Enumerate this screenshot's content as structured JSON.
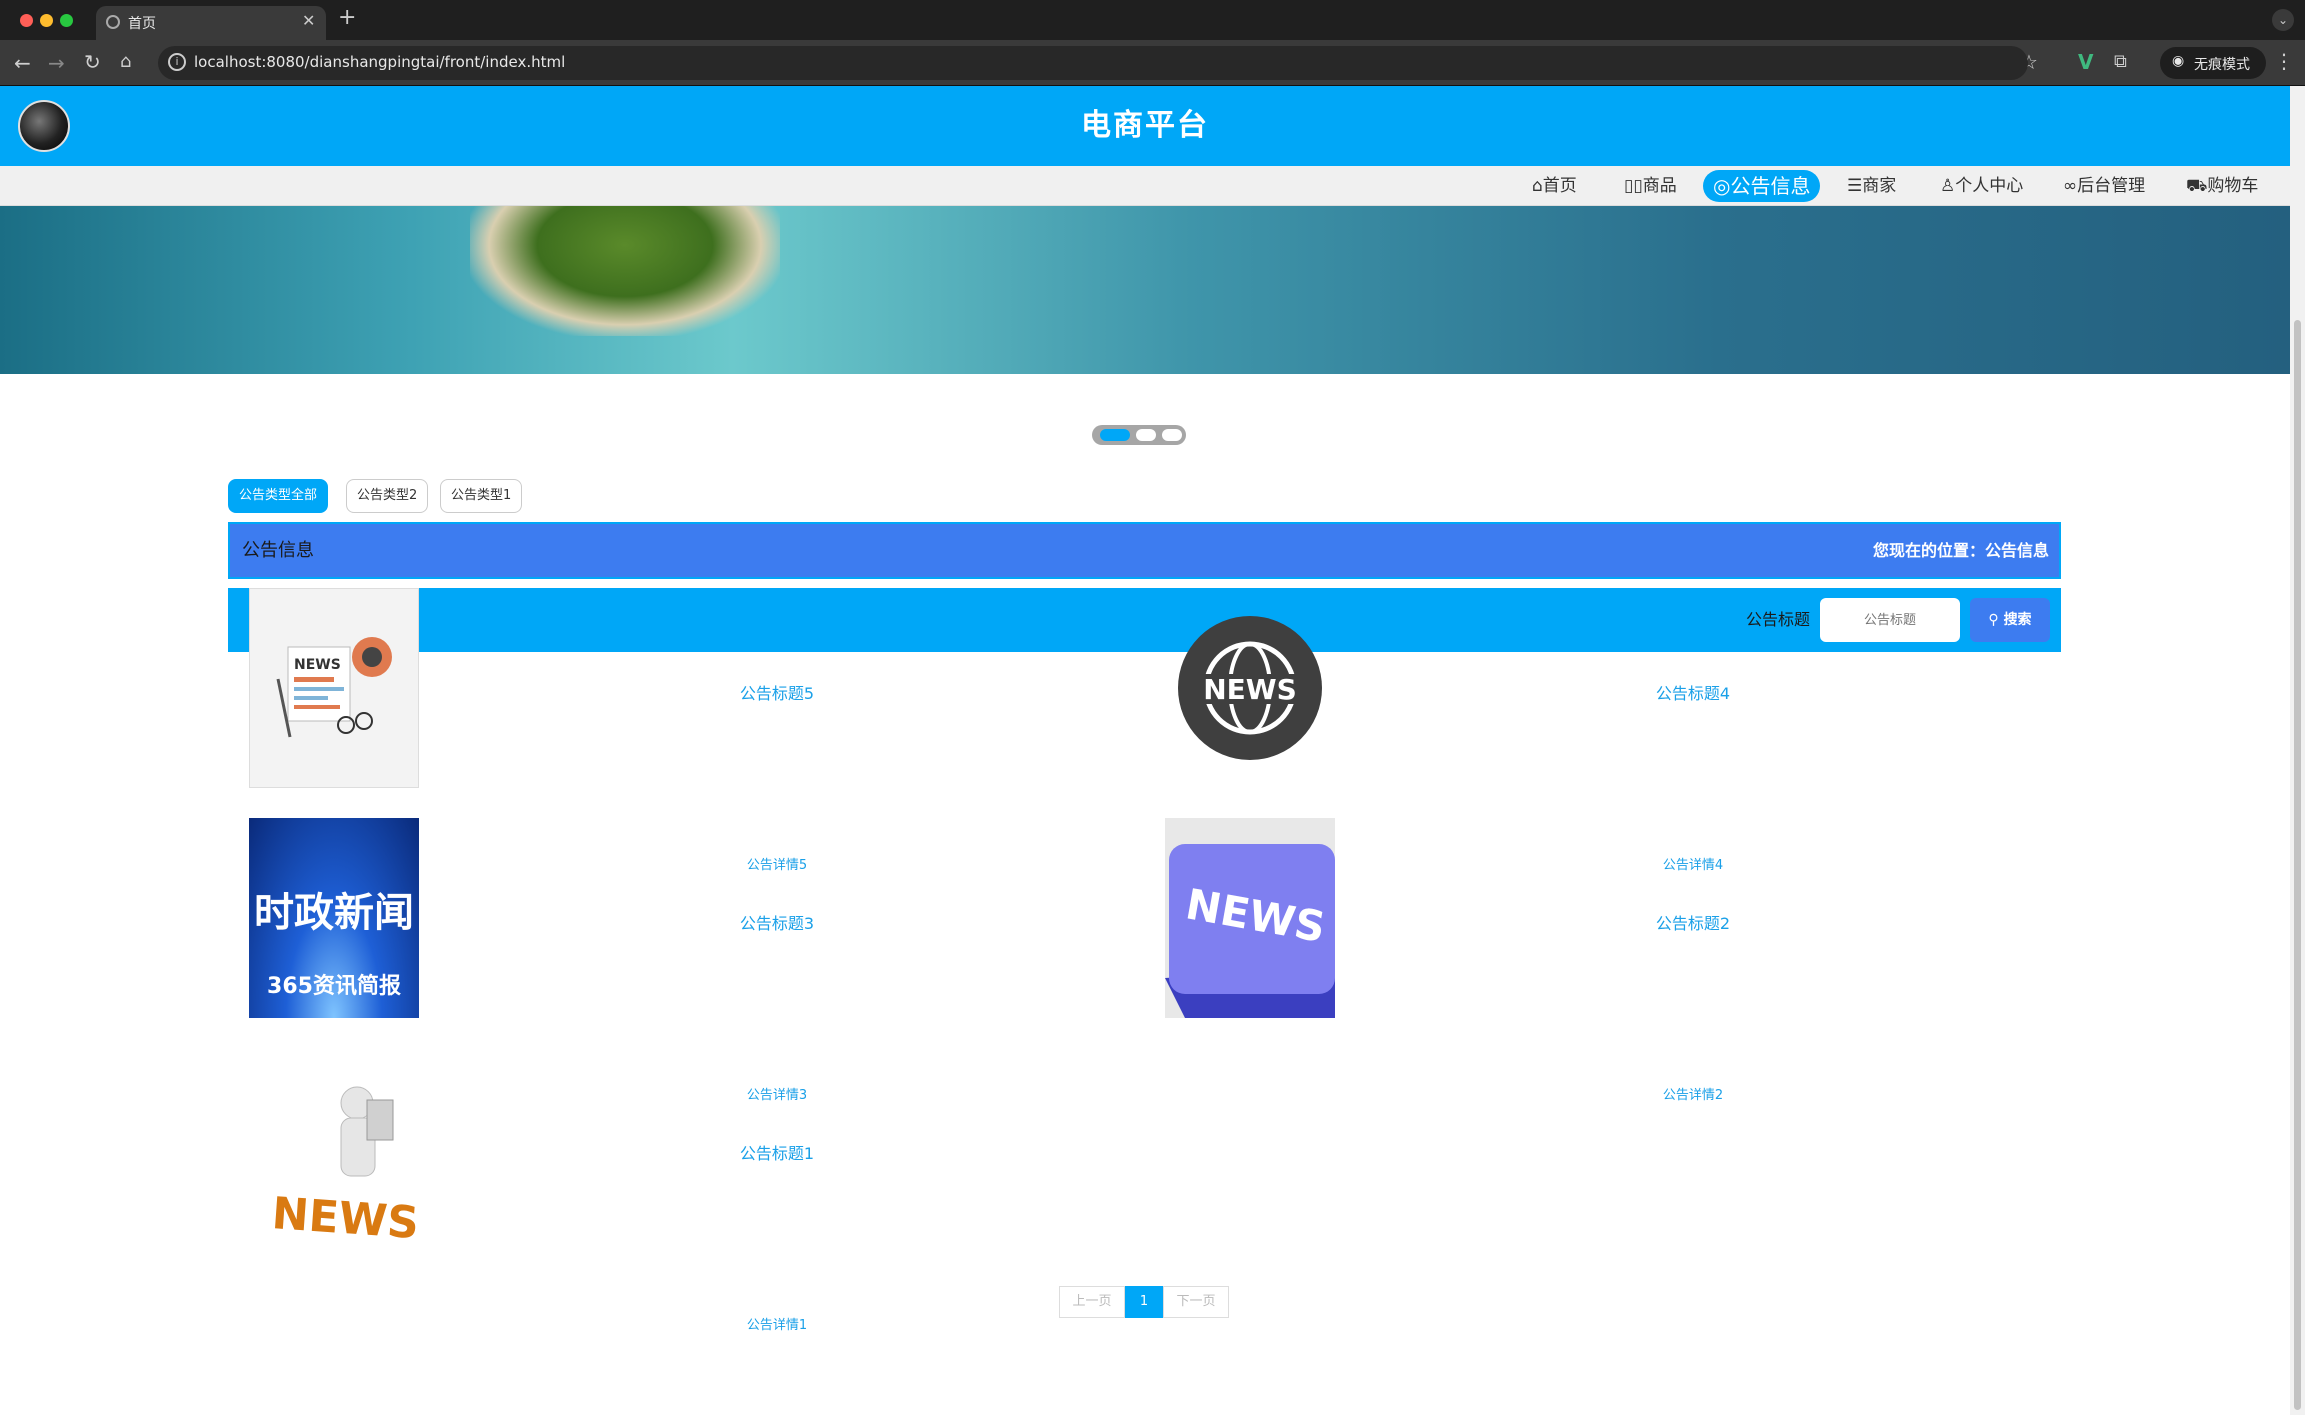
{
  "browser": {
    "tab_title": "首页",
    "url": "localhost:8080/dianshangpingtai/front/index.html",
    "incognito_label": "无痕模式"
  },
  "site": {
    "title": "电商平台"
  },
  "nav": {
    "items": [
      {
        "label": "首页",
        "icon": "home-icon"
      },
      {
        "label": "商品",
        "icon": "product-icon"
      },
      {
        "label": "公告信息",
        "icon": "announcement-icon",
        "active": true
      },
      {
        "label": "商家",
        "icon": "merchant-icon"
      },
      {
        "label": "个人中心",
        "icon": "user-icon"
      },
      {
        "label": "后台管理",
        "icon": "link-icon"
      },
      {
        "label": "购物车",
        "icon": "cart-icon"
      }
    ]
  },
  "types": {
    "items": [
      "公告类型全部",
      "公告类型2",
      "公告类型1"
    ],
    "active_index": 0
  },
  "info_bar": {
    "title": "公告信息",
    "location": "您现在的位置：公告信息"
  },
  "search": {
    "label": "公告标题",
    "placeholder": "公告标题",
    "button_label": "搜索"
  },
  "news": [
    {
      "title": "公告标题5",
      "detail": "公告详情5",
      "image": "news-paper-illustration"
    },
    {
      "title": "公告标题4",
      "detail": "公告详情4",
      "image": "news-globe-badge"
    },
    {
      "title": "公告标题3",
      "detail": "公告详情3",
      "image": "current-affairs-news-poster",
      "image_text": [
        "时政新闻",
        "365资讯简报"
      ]
    },
    {
      "title": "公告标题2",
      "detail": "公告详情2",
      "image": "news-keyboard-key"
    },
    {
      "title": "公告标题1",
      "detail": "公告详情1",
      "image": "person-reading-news-figure"
    }
  ],
  "pagination": {
    "prev_label": "上一页",
    "current_page": "1",
    "next_label": "下一页"
  },
  "colors": {
    "primary": "#00a7f7",
    "secondary": "#3d7cf0",
    "link": "#1aa0e8"
  }
}
